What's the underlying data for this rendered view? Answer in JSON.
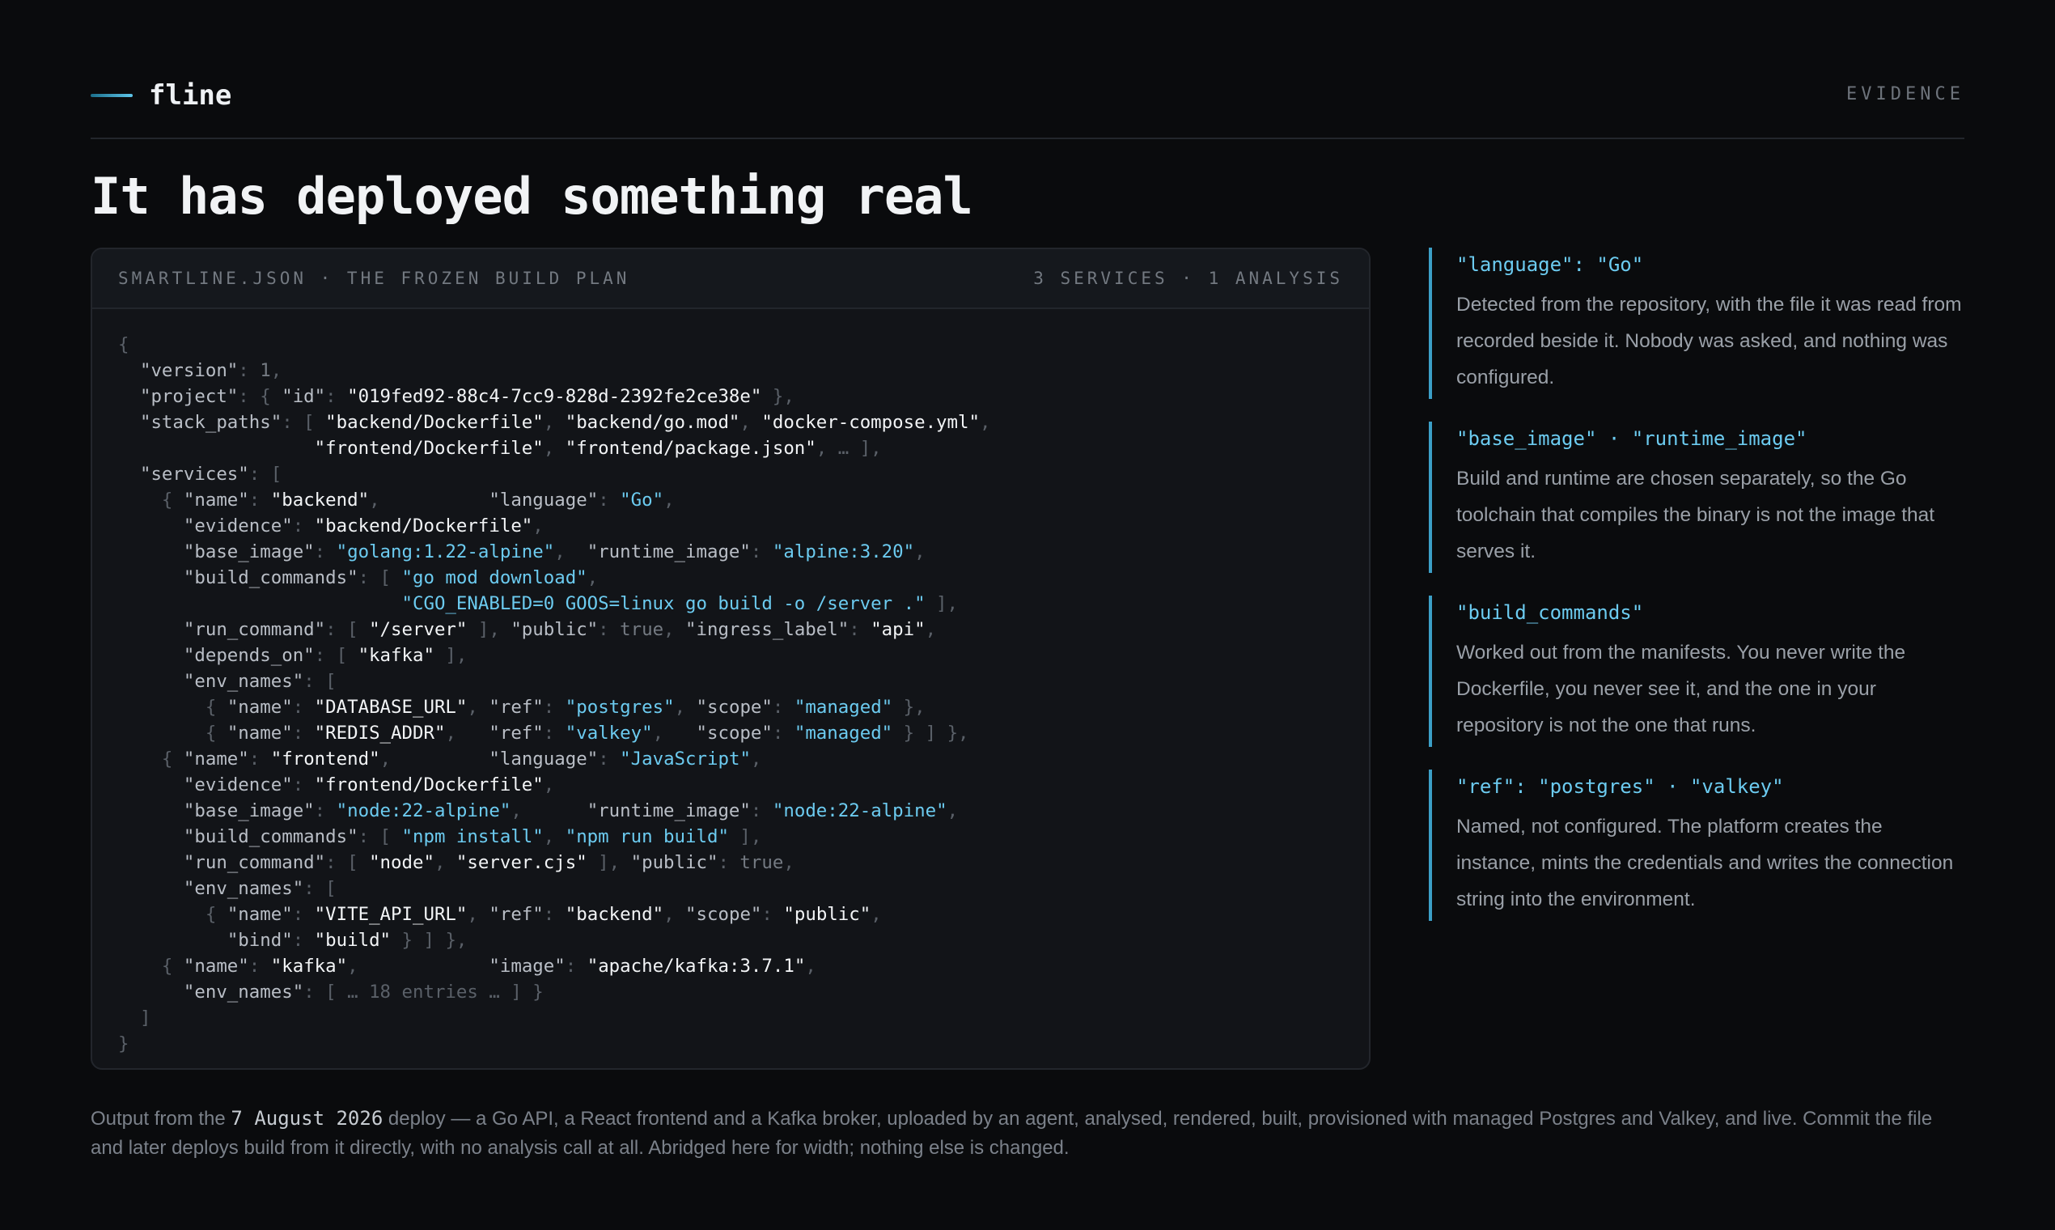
{
  "brand": {
    "name": "fline"
  },
  "section_tag": "EVIDENCE",
  "title": "It has deployed something real",
  "panel": {
    "left_label": "SMARTLINE.JSON · THE FROZEN BUILD PLAN",
    "right_label": "3 SERVICES · 1 ANALYSIS"
  },
  "notes": [
    {
      "key": "\"language\": \"Go\"",
      "text": "Detected from the repository, with the file it was read from recorded beside it. Nobody was asked, and nothing was configured."
    },
    {
      "key": "\"base_image\" · \"runtime_image\"",
      "text": "Build and runtime are chosen separately, so the Go toolchain that compiles the binary is not the image that serves it."
    },
    {
      "key": "\"build_commands\"",
      "text": "Worked out from the manifests. You never write the Dockerfile, you never see it, and the one in your repository is not the one that runs."
    },
    {
      "key": "\"ref\": \"postgres\" · \"valkey\"",
      "text": "Named, not configured. The platform creates the instance, mints the credentials and writes the connection string into the environment."
    }
  ],
  "footer": {
    "before": "Output from the ",
    "date": "7 August 2026",
    "after": " deploy — a Go API, a React frontend and a Kafka broker, uploaded by an agent, analysed, rendered, built, provisioned with managed Postgres and Valkey, and live. Commit the file and later deploys build from it directly, with no analysis call at all. Abridged here for width; nothing else is changed."
  },
  "code_lines": [
    [
      [
        "p",
        "{"
      ]
    ],
    [
      [
        "t",
        "  "
      ],
      [
        "k",
        "\"version\""
      ],
      [
        "p",
        ": "
      ],
      [
        "n",
        "1"
      ],
      [
        "p",
        ","
      ]
    ],
    [
      [
        "t",
        "  "
      ],
      [
        "k",
        "\"project\""
      ],
      [
        "p",
        ": { "
      ],
      [
        "k",
        "\"id\""
      ],
      [
        "p",
        ": "
      ],
      [
        "s",
        "\"019fed92-88c4-7cc9-828d-2392fe2ce38e\""
      ],
      [
        "p",
        " },"
      ]
    ],
    [
      [
        "t",
        "  "
      ],
      [
        "k",
        "\"stack_paths\""
      ],
      [
        "p",
        ": [ "
      ],
      [
        "s",
        "\"backend/Dockerfile\""
      ],
      [
        "p",
        ", "
      ],
      [
        "s",
        "\"backend/go.mod\""
      ],
      [
        "p",
        ", "
      ],
      [
        "s",
        "\"docker-compose.yml\""
      ],
      [
        "p",
        ","
      ]
    ],
    [
      [
        "t",
        "                  "
      ],
      [
        "s",
        "\"frontend/Dockerfile\""
      ],
      [
        "p",
        ", "
      ],
      [
        "s",
        "\"frontend/package.json\""
      ],
      [
        "p",
        ", … ],"
      ]
    ],
    [
      [
        "t",
        "  "
      ],
      [
        "k",
        "\"services\""
      ],
      [
        "p",
        ": ["
      ]
    ],
    [
      [
        "t",
        "    "
      ],
      [
        "p",
        "{ "
      ],
      [
        "k",
        "\"name\""
      ],
      [
        "p",
        ": "
      ],
      [
        "s",
        "\"backend\""
      ],
      [
        "p",
        ",          "
      ],
      [
        "k",
        "\"language\""
      ],
      [
        "p",
        ": "
      ],
      [
        "h",
        "\"Go\""
      ],
      [
        "p",
        ","
      ]
    ],
    [
      [
        "t",
        "      "
      ],
      [
        "k",
        "\"evidence\""
      ],
      [
        "p",
        ": "
      ],
      [
        "s",
        "\"backend/Dockerfile\""
      ],
      [
        "p",
        ","
      ]
    ],
    [
      [
        "t",
        "      "
      ],
      [
        "k",
        "\"base_image\""
      ],
      [
        "p",
        ": "
      ],
      [
        "h",
        "\"golang:1.22-alpine\""
      ],
      [
        "p",
        ",  "
      ],
      [
        "k",
        "\"runtime_image\""
      ],
      [
        "p",
        ": "
      ],
      [
        "h",
        "\"alpine:3.20\""
      ],
      [
        "p",
        ","
      ]
    ],
    [
      [
        "t",
        "      "
      ],
      [
        "k",
        "\"build_commands\""
      ],
      [
        "p",
        ": [ "
      ],
      [
        "h",
        "\"go mod download\""
      ],
      [
        "p",
        ","
      ]
    ],
    [
      [
        "t",
        "                          "
      ],
      [
        "h",
        "\"CGO_ENABLED=0 GOOS=linux go build -o /server .\""
      ],
      [
        "p",
        " ],"
      ]
    ],
    [
      [
        "t",
        "      "
      ],
      [
        "k",
        "\"run_command\""
      ],
      [
        "p",
        ": [ "
      ],
      [
        "s",
        "\"/server\""
      ],
      [
        "p",
        " ], "
      ],
      [
        "k",
        "\"public\""
      ],
      [
        "p",
        ": "
      ],
      [
        "n",
        "true"
      ],
      [
        "p",
        ", "
      ],
      [
        "k",
        "\"ingress_label\""
      ],
      [
        "p",
        ": "
      ],
      [
        "s",
        "\"api\""
      ],
      [
        "p",
        ","
      ]
    ],
    [
      [
        "t",
        "      "
      ],
      [
        "k",
        "\"depends_on\""
      ],
      [
        "p",
        ": [ "
      ],
      [
        "s",
        "\"kafka\""
      ],
      [
        "p",
        " ],"
      ]
    ],
    [
      [
        "t",
        "      "
      ],
      [
        "k",
        "\"env_names\""
      ],
      [
        "p",
        ": ["
      ]
    ],
    [
      [
        "t",
        "        "
      ],
      [
        "p",
        "{ "
      ],
      [
        "k",
        "\"name\""
      ],
      [
        "p",
        ": "
      ],
      [
        "s",
        "\"DATABASE_URL\""
      ],
      [
        "p",
        ", "
      ],
      [
        "k",
        "\"ref\""
      ],
      [
        "p",
        ": "
      ],
      [
        "h",
        "\"postgres\""
      ],
      [
        "p",
        ", "
      ],
      [
        "k",
        "\"scope\""
      ],
      [
        "p",
        ": "
      ],
      [
        "h",
        "\"managed\""
      ],
      [
        "p",
        " },"
      ]
    ],
    [
      [
        "t",
        "        "
      ],
      [
        "p",
        "{ "
      ],
      [
        "k",
        "\"name\""
      ],
      [
        "p",
        ": "
      ],
      [
        "s",
        "\"REDIS_ADDR\""
      ],
      [
        "p",
        ",   "
      ],
      [
        "k",
        "\"ref\""
      ],
      [
        "p",
        ": "
      ],
      [
        "h",
        "\"valkey\""
      ],
      [
        "p",
        ",   "
      ],
      [
        "k",
        "\"scope\""
      ],
      [
        "p",
        ": "
      ],
      [
        "h",
        "\"managed\""
      ],
      [
        "p",
        " } ] },"
      ]
    ],
    [
      [
        "t",
        "    "
      ],
      [
        "p",
        "{ "
      ],
      [
        "k",
        "\"name\""
      ],
      [
        "p",
        ": "
      ],
      [
        "s",
        "\"frontend\""
      ],
      [
        "p",
        ",         "
      ],
      [
        "k",
        "\"language\""
      ],
      [
        "p",
        ": "
      ],
      [
        "h",
        "\"JavaScript\""
      ],
      [
        "p",
        ","
      ]
    ],
    [
      [
        "t",
        "      "
      ],
      [
        "k",
        "\"evidence\""
      ],
      [
        "p",
        ": "
      ],
      [
        "s",
        "\"frontend/Dockerfile\""
      ],
      [
        "p",
        ","
      ]
    ],
    [
      [
        "t",
        "      "
      ],
      [
        "k",
        "\"base_image\""
      ],
      [
        "p",
        ": "
      ],
      [
        "h",
        "\"node:22-alpine\""
      ],
      [
        "p",
        ",      "
      ],
      [
        "k",
        "\"runtime_image\""
      ],
      [
        "p",
        ": "
      ],
      [
        "h",
        "\"node:22-alpine\""
      ],
      [
        "p",
        ","
      ]
    ],
    [
      [
        "t",
        "      "
      ],
      [
        "k",
        "\"build_commands\""
      ],
      [
        "p",
        ": [ "
      ],
      [
        "h",
        "\"npm install\""
      ],
      [
        "p",
        ", "
      ],
      [
        "h",
        "\"npm run build\""
      ],
      [
        "p",
        " ],"
      ]
    ],
    [
      [
        "t",
        "      "
      ],
      [
        "k",
        "\"run_command\""
      ],
      [
        "p",
        ": [ "
      ],
      [
        "s",
        "\"node\""
      ],
      [
        "p",
        ", "
      ],
      [
        "s",
        "\"server.cjs\""
      ],
      [
        "p",
        " ], "
      ],
      [
        "k",
        "\"public\""
      ],
      [
        "p",
        ": "
      ],
      [
        "n",
        "true"
      ],
      [
        "p",
        ","
      ]
    ],
    [
      [
        "t",
        "      "
      ],
      [
        "k",
        "\"env_names\""
      ],
      [
        "p",
        ": ["
      ]
    ],
    [
      [
        "t",
        "        "
      ],
      [
        "p",
        "{ "
      ],
      [
        "k",
        "\"name\""
      ],
      [
        "p",
        ": "
      ],
      [
        "s",
        "\"VITE_API_URL\""
      ],
      [
        "p",
        ", "
      ],
      [
        "k",
        "\"ref\""
      ],
      [
        "p",
        ": "
      ],
      [
        "s",
        "\"backend\""
      ],
      [
        "p",
        ", "
      ],
      [
        "k",
        "\"scope\""
      ],
      [
        "p",
        ": "
      ],
      [
        "s",
        "\"public\""
      ],
      [
        "p",
        ","
      ]
    ],
    [
      [
        "t",
        "          "
      ],
      [
        "k",
        "\"bind\""
      ],
      [
        "p",
        ": "
      ],
      [
        "s",
        "\"build\""
      ],
      [
        "p",
        " } ] },"
      ]
    ],
    [
      [
        "t",
        "    "
      ],
      [
        "p",
        "{ "
      ],
      [
        "k",
        "\"name\""
      ],
      [
        "p",
        ": "
      ],
      [
        "s",
        "\"kafka\""
      ],
      [
        "p",
        ",            "
      ],
      [
        "k",
        "\"image\""
      ],
      [
        "p",
        ": "
      ],
      [
        "s",
        "\"apache/kafka:3.7.1\""
      ],
      [
        "p",
        ","
      ]
    ],
    [
      [
        "t",
        "      "
      ],
      [
        "k",
        "\"env_names\""
      ],
      [
        "p",
        ": [ … 18 entries … ] }"
      ]
    ],
    [
      [
        "t",
        "  "
      ],
      [
        "p",
        "]"
      ]
    ],
    [
      [
        "p",
        "}"
      ]
    ]
  ]
}
